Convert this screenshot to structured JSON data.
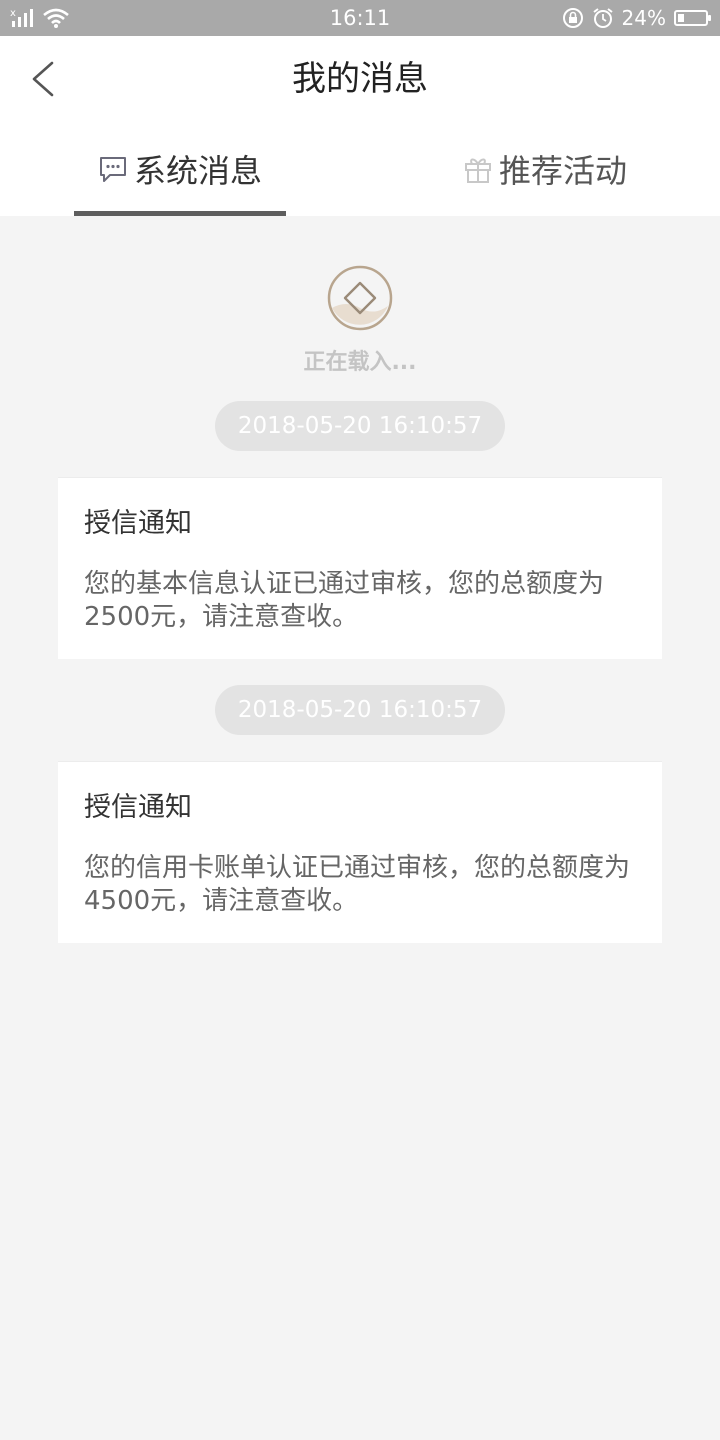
{
  "status_bar": {
    "time": "16:11",
    "battery_percent_text": "24%",
    "battery_level": 0.24,
    "icons": [
      "signal-icon",
      "wifi-icon",
      "rotation-lock-icon",
      "alarm-icon",
      "battery-icon"
    ]
  },
  "header": {
    "title": "我的消息",
    "back_icon": "chevron-left-icon"
  },
  "tabs": [
    {
      "label": "系统消息",
      "icon": "chat-bubble-icon",
      "active": true
    },
    {
      "label": "推荐活动",
      "icon": "gift-icon",
      "active": false
    }
  ],
  "loading": {
    "text": "正在载入..."
  },
  "messages": [
    {
      "timestamp": "2018-05-20 16:10:57",
      "title": "授信通知",
      "body": "您的基本信息认证已通过审核，您的总额度为2500元，请注意查收。"
    },
    {
      "timestamp": "2018-05-20 16:10:57",
      "title": "授信通知",
      "body": "您的信用卡账单认证已通过审核，您的总额度为4500元，请注意查收。"
    }
  ],
  "colors": {
    "status_bar_bg": "#a9a9a9",
    "page_bg": "#f4f4f4",
    "tab_underline": "#5e5e5e",
    "loading_accent": "#b8a58e"
  }
}
